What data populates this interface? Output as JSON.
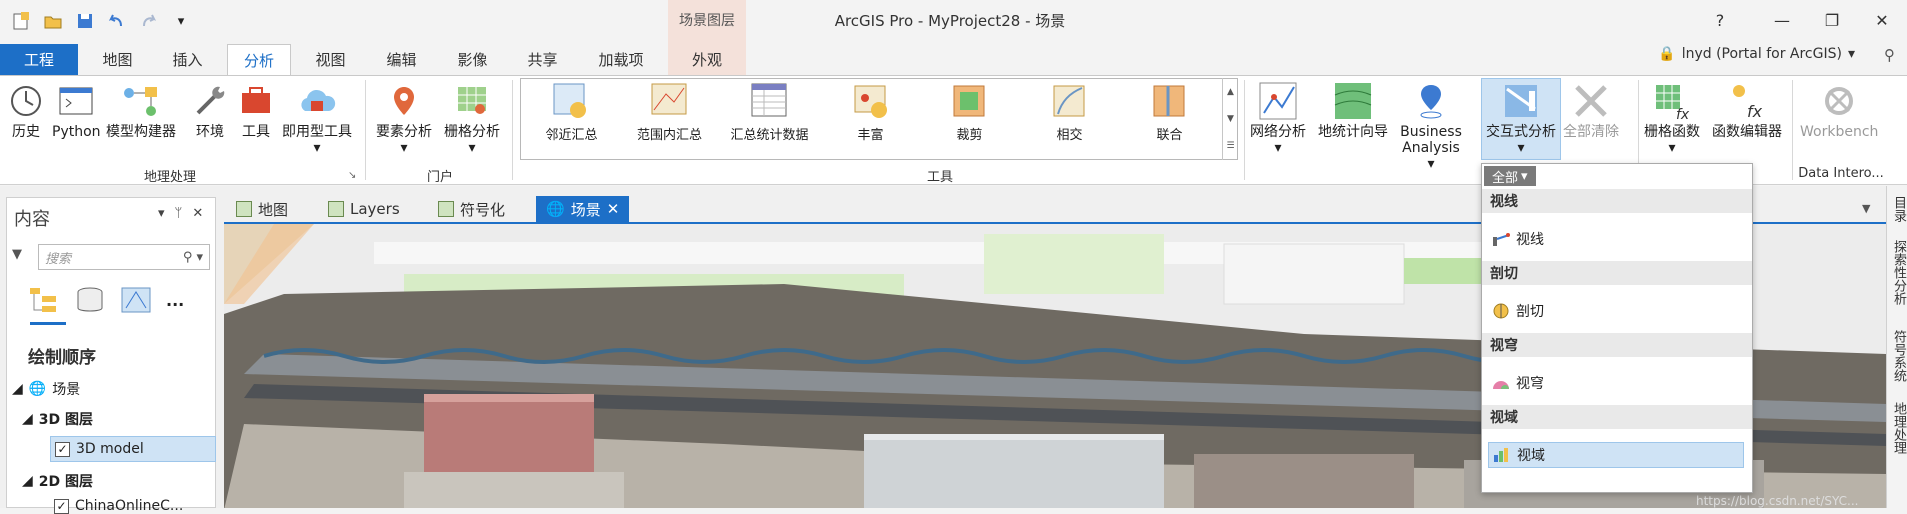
{
  "window": {
    "title": "ArcGIS Pro - MyProject28 - 场景",
    "help": "?"
  },
  "context_tab": {
    "group": "场景图层",
    "tab": "外观"
  },
  "tabs": [
    "工程",
    "地图",
    "插入",
    "分析",
    "视图",
    "编辑",
    "影像",
    "共享",
    "加载项"
  ],
  "user": "lnyd (Portal for ArcGIS)",
  "ribbon": {
    "geoprocessing": {
      "label": "地理处理",
      "buttons": [
        "历史",
        "Python",
        "模型构建器",
        "环境",
        "工具",
        "即用型工具"
      ]
    },
    "portal": {
      "label": "门户",
      "buttons": [
        "要素分析",
        "栅格分析"
      ]
    },
    "tools": {
      "label": "工具",
      "items": [
        "邻近汇总",
        "范围内汇总",
        "汇总统计数据",
        "丰富",
        "裁剪",
        "相交",
        "联合"
      ]
    },
    "workflows": {
      "buttons": [
        "网络分析",
        "地统计向导",
        "Business Analysis"
      ]
    },
    "interactive": {
      "buttons": [
        "交互式分析",
        "全部清除"
      ]
    },
    "raster": {
      "buttons": [
        "栅格函数",
        "函数编辑器"
      ]
    },
    "data_interop": {
      "label": "Data Intero...",
      "button": "Workbench"
    }
  },
  "contents": {
    "title": "内容",
    "search_placeholder": "搜索",
    "more": "...",
    "draw_order": "绘制顺序",
    "tree": {
      "scene": "场景",
      "layers3d": "3D 图层",
      "model": "3D model",
      "layers2d": "2D 图层",
      "partial": "ChinaOnlineC..."
    }
  },
  "view_tabs": [
    "地图",
    "Layers",
    "符号化",
    "场景"
  ],
  "dropdown": {
    "filter": "全部",
    "sections": [
      {
        "header": "视线",
        "item": "视线"
      },
      {
        "header": "剖切",
        "item": "剖切"
      },
      {
        "header": "视穹",
        "item": "视穹"
      },
      {
        "header": "视域",
        "item": "视域"
      }
    ]
  },
  "side_panes": [
    "目录",
    "探索性分析",
    "符号系统",
    "地理处理"
  ],
  "watermark": "https://blog.csdn.net/SYC..."
}
